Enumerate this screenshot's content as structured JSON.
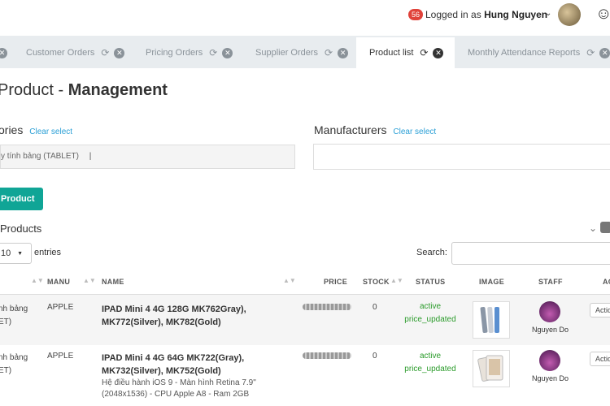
{
  "header": {
    "notifications": "56",
    "logged_in_prefix": "Logged in as",
    "user_name": "Hung Nguyen"
  },
  "tabs": [
    {
      "label": "Customer Orders"
    },
    {
      "label": "Pricing Orders"
    },
    {
      "label": "Supplier Orders"
    },
    {
      "label": "Product list"
    },
    {
      "label": "Monthly Attendance Reports"
    }
  ],
  "page": {
    "title_prefix": "Product - ",
    "title_bold": "Management"
  },
  "filters": {
    "categories_label": "ories",
    "categories_clear": "Clear select",
    "categories_tag": "y tính bảng (TABLET)",
    "manufacturers_label": "Manufacturers",
    "manufacturers_clear": "Clear select"
  },
  "add_button": "Product",
  "products_section": {
    "title": "Products",
    "length_value": "10",
    "entries_label": "entries",
    "search_label": "Search:"
  },
  "table": {
    "columns": [
      "MANU",
      "NAME",
      "PRICE",
      "STOCK",
      "STATUS",
      "IMAGE",
      "STAFF",
      "AC"
    ],
    "rows": [
      {
        "category_line1": "nh bảng",
        "category_line2": "ET)",
        "manu": "APPLE",
        "name": "IPAD Mini 4 4G 128G MK762Gray), MK772(Silver), MK782(Gold)",
        "description": "",
        "stock": "0",
        "status1": "active",
        "status2": "price_updated",
        "staff": "Nguyen Do",
        "action": "Actio"
      },
      {
        "category_line1": "nh bảng",
        "category_line2": "ET)",
        "manu": "APPLE",
        "name": "IPAD Mini 4 4G 64G MK722(Gray), MK732(Silver), MK752(Gold)",
        "description": "Hệ điều hành iOS 9 - Màn hình Retina 7.9\" (2048x1536) - CPU Apple A8 - Ram 2GB",
        "stock": "0",
        "status1": "active",
        "status2": "price_updated",
        "staff": "Nguyen Do",
        "action": "Actio"
      }
    ]
  }
}
